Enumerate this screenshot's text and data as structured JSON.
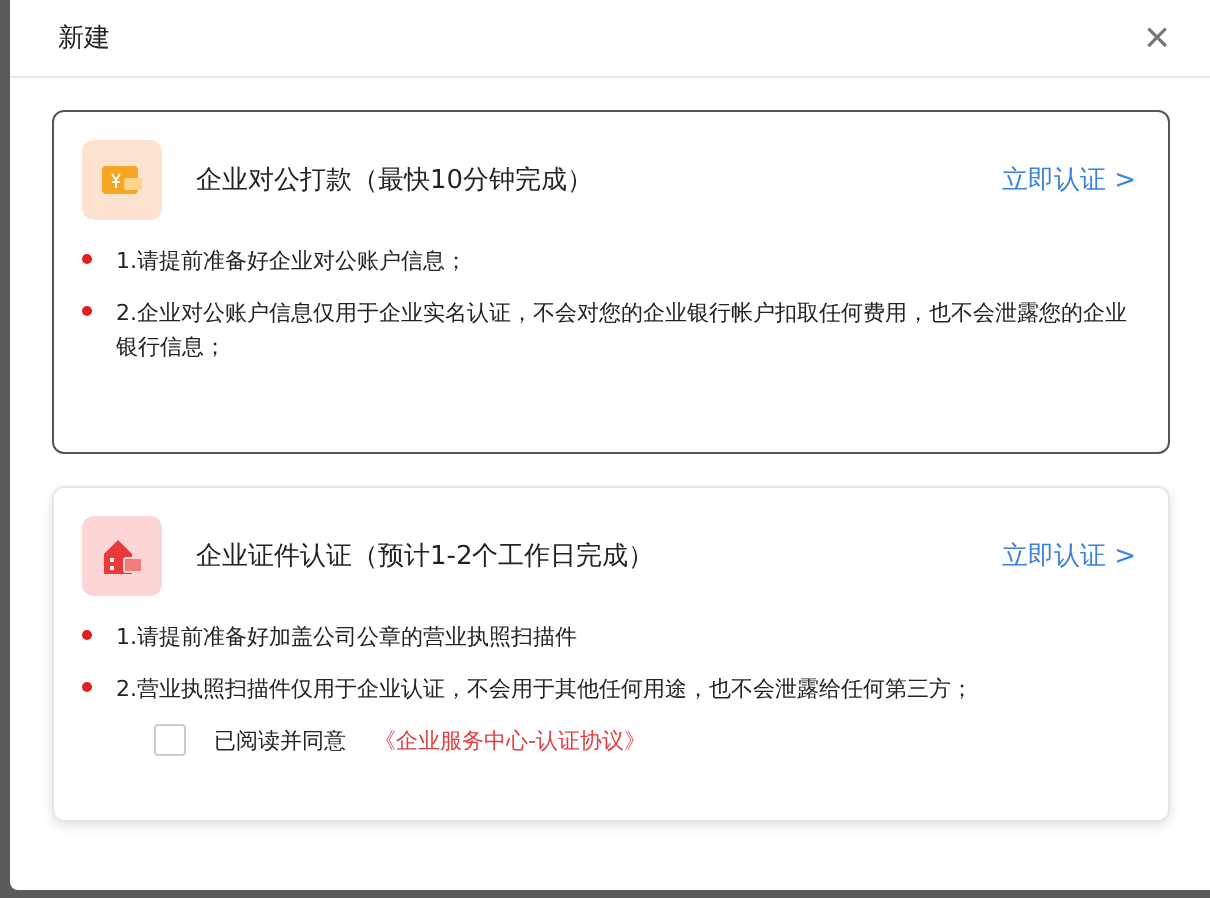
{
  "dialog": {
    "title": "新建",
    "close": "×"
  },
  "options": [
    {
      "kind": "bank",
      "selected": true,
      "title": "企业对公打款（最快10分钟完成）",
      "action": "立即认证 >",
      "notes": [
        "1.请提前准备好企业对公账户信息；",
        "2.企业对公账户信息仅用于企业实名认证，不会对您的企业银行帐户扣取任何费用，也不会泄露您的企业银行信息；"
      ]
    },
    {
      "kind": "license",
      "selected": false,
      "title": "企业证件认证（预计1-2个工作日完成）",
      "action": "立即认证 >",
      "notes": [
        "1.请提前准备好加盖公司公章的营业执照扫描件",
        "2.营业执照扫描件仅用于企业认证，不会用于其他任何用途，也不会泄露给任何第三方；"
      ],
      "agreement": {
        "checked": false,
        "label": "已阅读并同意",
        "link": "《企业服务中心-认证协议》"
      }
    }
  ]
}
